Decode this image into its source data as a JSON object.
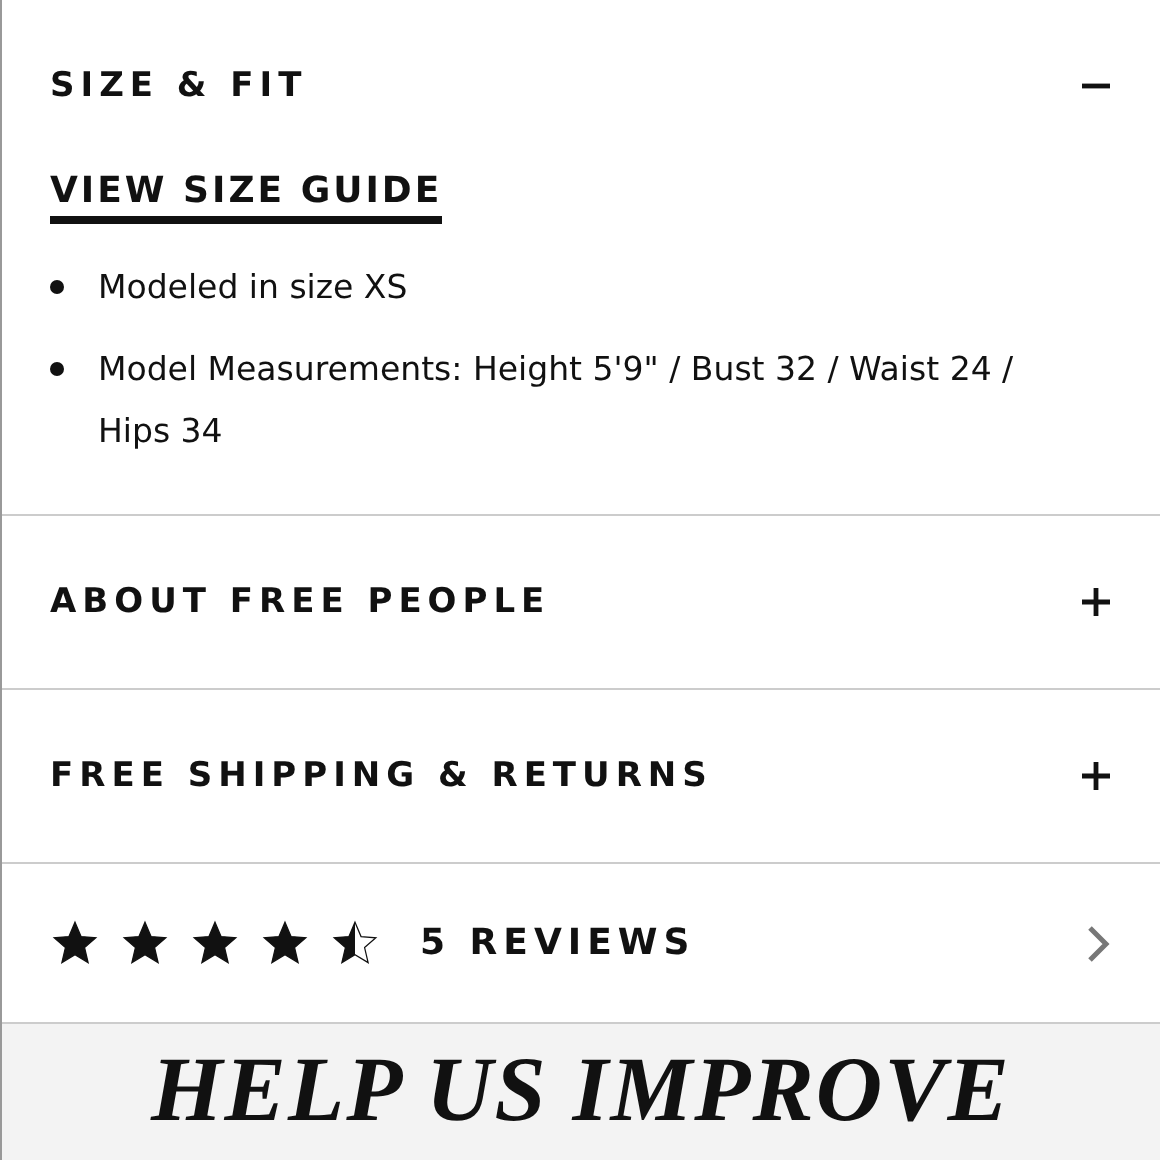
{
  "sections": [
    {
      "title": "SIZE & FIT",
      "expanded": true,
      "link": "VIEW SIZE GUIDE",
      "bullets": [
        "Modeled in size XS",
        "Model Measurements: Height 5'9\" / Bust 32 / Waist 24 / Hips 34"
      ]
    },
    {
      "title": "ABOUT FREE PEOPLE",
      "expanded": false
    },
    {
      "title": "FREE SHIPPING & RETURNS",
      "expanded": false
    }
  ],
  "reviews": {
    "stars": 4.5,
    "label": "5 REVIEWS"
  },
  "feedback": {
    "heading": "HELP US IMPROVE"
  }
}
